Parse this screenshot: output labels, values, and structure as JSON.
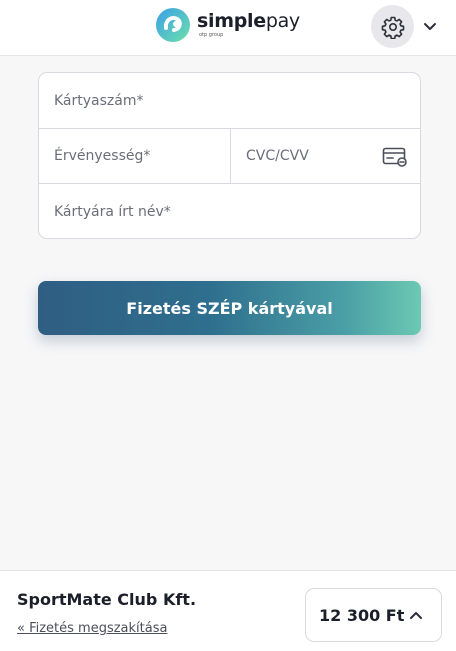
{
  "header": {
    "logo": {
      "word_bold": "simple",
      "word_light": "pay",
      "sub": "otp group",
      "icon": "simplepay-logo-icon"
    },
    "settings_icon": "gear-icon",
    "menu_icon": "chevron-down-icon"
  },
  "form": {
    "card_number_placeholder": "Kártyaszám*",
    "expiry_placeholder": "Érvényesség*",
    "cvc_placeholder": "CVC/CVV",
    "cvc_icon": "card-cvc-icon",
    "name_placeholder": "Kártyára írt név*"
  },
  "pay_button": {
    "label": "Fizetés SZÉP kártyával"
  },
  "footer": {
    "merchant": "SportMate Club Kft.",
    "cancel_link": "« Fizetés megszakítása",
    "amount": "12 300 Ft",
    "amount_icon": "chevron-up-icon"
  },
  "colors": {
    "gradient_start": "#2f5e82",
    "gradient_end": "#6cc9b3",
    "background": "#f7f7f8"
  }
}
